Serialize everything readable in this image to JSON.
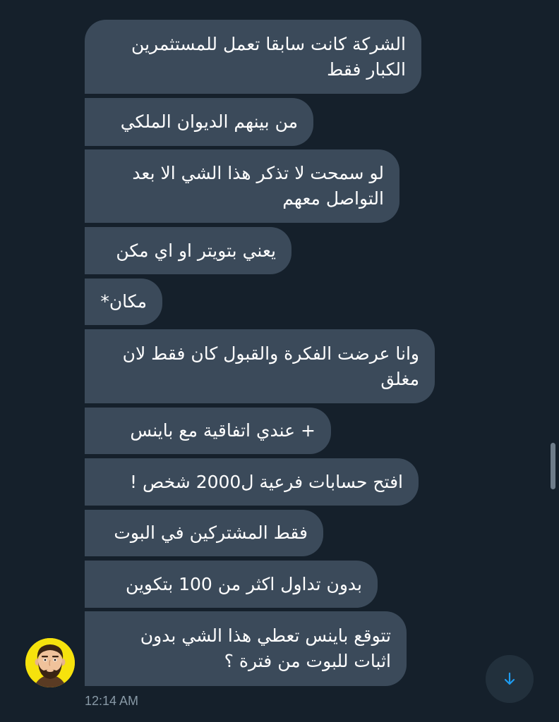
{
  "messages": [
    {
      "lines": [
        "الشركة كانت سابقا تعمل للمستثمرين",
        "الكبار فقط"
      ]
    },
    {
      "lines": [
        "من بينهم الديوان الملكي"
      ]
    },
    {
      "lines": [
        "لو سمحت لا تذكر هذا الشي الا بعد",
        "التواصل معهم"
      ]
    },
    {
      "lines": [
        "يعني بتويتر او اي مكن"
      ]
    },
    {
      "lines": [
        "مكان*"
      ]
    },
    {
      "lines": [
        "وانا عرضت الفكرة والقبول كان فقط لان",
        "مغلق"
      ]
    },
    {
      "lines": [
        "+ عندي اتفاقية مع باينس"
      ]
    },
    {
      "lines": [
        "افتح حسابات فرعية ل2000 شخص !"
      ]
    },
    {
      "lines": [
        "فقط المشتركين في البوت"
      ]
    },
    {
      "lines": [
        "بدون تداول اكثر من 100 بتكوين"
      ]
    },
    {
      "lines": [
        "تتوقع باينس تعطي هذا الشي بدون",
        "اثبات للبوت من فترة ؟"
      ]
    }
  ],
  "timestamp": "12:14 AM",
  "icons": {
    "scroll_down": "arrow-down-icon",
    "avatar": "bearded-man-avatar"
  },
  "colors": {
    "background": "#15202b",
    "bubble": "#3b4a5a",
    "text": "#ffffff",
    "timestamp": "#8899a6",
    "accent": "#1d9bf0",
    "avatar_bg": "#f6e20d"
  }
}
